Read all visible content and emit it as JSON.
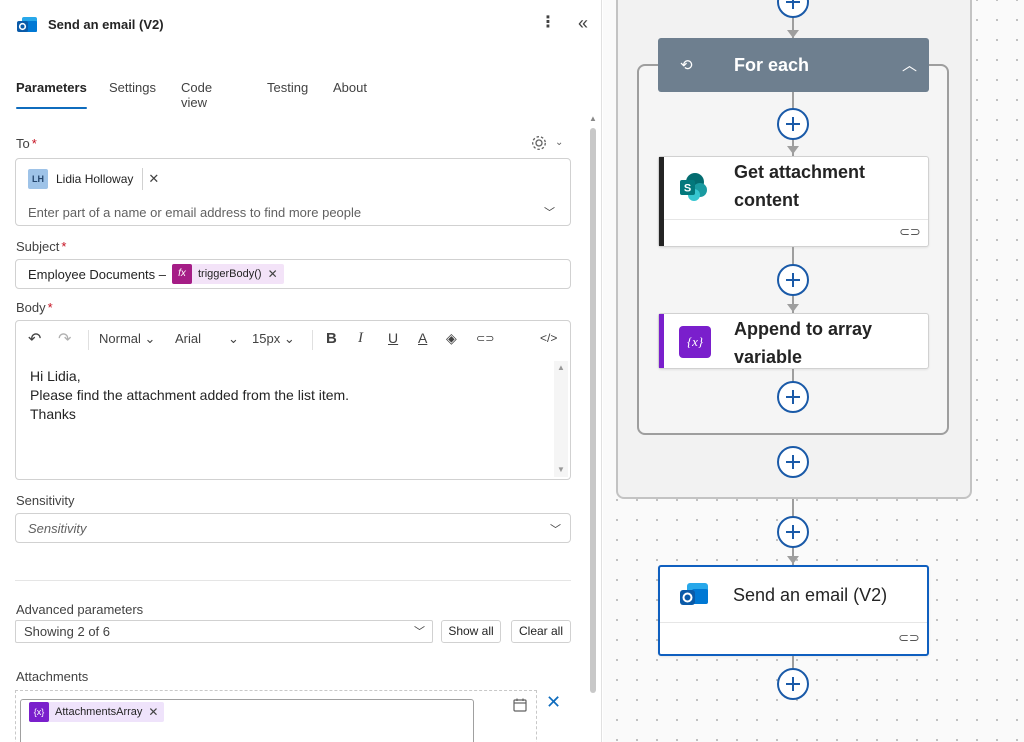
{
  "panel": {
    "title": "Send an email (V2)",
    "more_glyph": "⋮",
    "collapse_glyph": "«",
    "tabs": [
      {
        "label": "Parameters",
        "active": true
      },
      {
        "label": "Settings",
        "active": false
      },
      {
        "label": "Code view",
        "active": false
      },
      {
        "label": "Testing",
        "active": false
      },
      {
        "label": "About",
        "active": false
      }
    ],
    "to": {
      "label": "To",
      "required_mark": "*",
      "recipient_initials": "LH",
      "recipient_name": "Lidia Holloway",
      "remove_glyph": "✕",
      "placeholder": "Enter part of a name or email address to find more people"
    },
    "subject": {
      "label": "Subject",
      "required_mark": "*",
      "text": "Employee Documents –",
      "token_icon": "fx",
      "token_label": "triggerBody()",
      "token_remove": "✕"
    },
    "body": {
      "label": "Body",
      "required_mark": "*",
      "toolbar": {
        "undo": "↶",
        "redo": "↷",
        "format": "Normal",
        "font": "Arial",
        "size": "15px",
        "bold": "B",
        "italic": "I",
        "underline": "U",
        "font_color": "A",
        "highlight": "◈",
        "link": "⊂⊃",
        "code": "</>"
      },
      "lines": [
        "Hi Lidia,",
        "Please find the attachment added from the list item.",
        "Thanks"
      ]
    },
    "sensitivity": {
      "label": "Sensitivity",
      "placeholder": "Sensitivity"
    },
    "advanced": {
      "label": "Advanced parameters",
      "value": "Showing 2 of 6",
      "show_all": "Show all",
      "clear_all": "Clear all"
    },
    "attachments": {
      "label": "Attachments",
      "token_icon": "{x}",
      "token_label": "AttachmentsArray",
      "token_remove": "✕",
      "remove_glyph": "✕"
    }
  },
  "canvas": {
    "foreach_title": "For each",
    "foreach_icon": "⟲",
    "foreach_collapse": "︿",
    "cards": [
      {
        "id": "get-attachment",
        "title_lines": [
          "Get attachment",
          "content"
        ],
        "link_glyph": "⊂⊃",
        "accent": "#242424"
      },
      {
        "id": "append-array",
        "title_lines": [
          "Append to array",
          "variable"
        ],
        "icon_text": "{x}",
        "accent": "#7a1fcc"
      },
      {
        "id": "send-email",
        "title_lines": [
          "Send an email (V2)"
        ],
        "link_glyph": "⊂⊃",
        "accent": "#0f5fbf"
      }
    ]
  },
  "colors": {
    "accent": "#0f6cbd",
    "fx_token": "#a51d86",
    "variable": "#7a1fcc",
    "foreach_bar": "#6e7f8f"
  }
}
